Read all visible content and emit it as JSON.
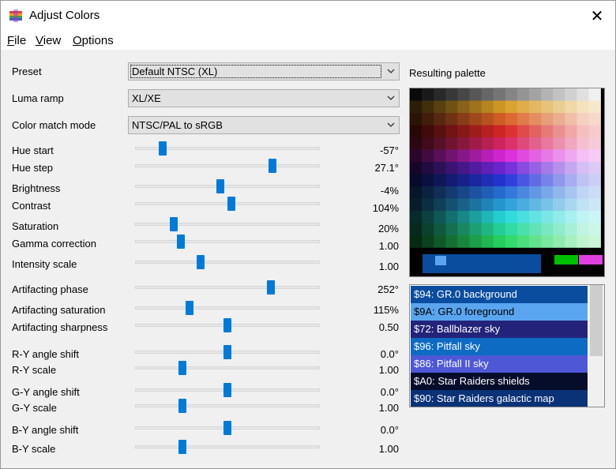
{
  "window": {
    "title": "Adjust Colors",
    "close_glyph": "✕"
  },
  "menu": [
    {
      "underline": "F",
      "rest": "ile"
    },
    {
      "underline": "V",
      "rest": "iew"
    },
    {
      "underline": "O",
      "rest": "ptions"
    }
  ],
  "combos": {
    "preset": {
      "label": "Preset",
      "value": "Default NTSC (XL)"
    },
    "luma_ramp": {
      "label": "Luma ramp",
      "value": "XL/XE"
    },
    "color_match": {
      "label": "Color match mode",
      "value": "NTSC/PAL to sRGB"
    }
  },
  "sliders": [
    {
      "label": "Hue start",
      "value": "-57°",
      "position": 0.145
    },
    {
      "label": "Hue step",
      "value": "27.1°",
      "position": 0.745
    },
    {
      "label": "Brightness",
      "value": "-4%",
      "position": 0.46
    },
    {
      "label": "Contrast",
      "value": "104%",
      "position": 0.52
    },
    {
      "label": "Saturation",
      "value": "20%",
      "position": 0.205
    },
    {
      "label": "Gamma correction",
      "value": "1.00",
      "position": 0.245
    },
    {
      "label": "Intensity scale",
      "value": "1.00",
      "position": 0.355
    },
    {
      "label": "Artifacting phase",
      "value": "252°",
      "position": 0.735
    },
    {
      "label": "Artifacting saturation",
      "value": "115%",
      "position": 0.295
    },
    {
      "label": "Artifacting sharpness",
      "value": "0.50",
      "position": 0.5
    },
    {
      "label": "R-Y angle shift",
      "value": "0.0°",
      "position": 0.5
    },
    {
      "label": "R-Y scale",
      "value": "1.00",
      "position": 0.255
    },
    {
      "label": "G-Y angle shift",
      "value": "0.0°",
      "position": 0.5
    },
    {
      "label": "G-Y scale",
      "value": "1.00",
      "position": 0.255
    },
    {
      "label": "B-Y angle shift",
      "value": "0.0°",
      "position": 0.5
    },
    {
      "label": "B-Y scale",
      "value": "1.00",
      "position": 0.255
    }
  ],
  "palette": {
    "label": "Resulting palette",
    "background_bar": "#0a4d9e",
    "bar_marker": "#5aa5f0",
    "swatch_green": "#00c000",
    "swatch_magenta": "#e040e0"
  },
  "list": [
    {
      "text": "$94: GR.0 background",
      "bg": "#0a4d9e",
      "fg": "#ffffff"
    },
    {
      "text": "$9A: GR.0 foreground",
      "bg": "#5aa5f0",
      "fg": "#000000"
    },
    {
      "text": "$72: Ballblazer sky",
      "bg": "#24237a",
      "fg": "#ffffff"
    },
    {
      "text": "$96: Pitfall sky",
      "bg": "#0d6bc4",
      "fg": "#ffffff"
    },
    {
      "text": "$86: Pitfall II sky",
      "bg": "#4e58d6",
      "fg": "#ffffff"
    },
    {
      "text": "$A0: Star Raiders shields",
      "bg": "#050d2b",
      "fg": "#ffffff"
    },
    {
      "text": "$90: Star Raiders galactic map",
      "bg": "#0a3277",
      "fg": "#ffffff"
    }
  ]
}
